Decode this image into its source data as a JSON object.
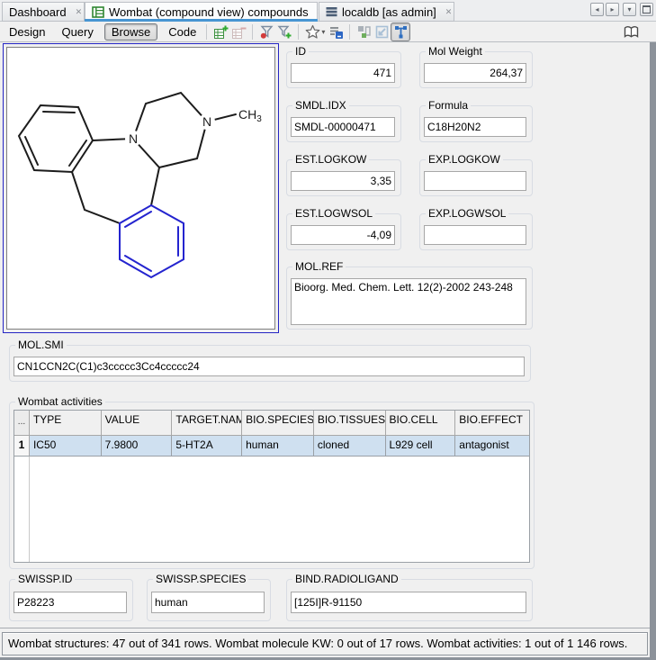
{
  "tabs": {
    "items": [
      {
        "label": "Dashboard",
        "close": "✕"
      },
      {
        "label": "Wombat (compound view) compounds",
        "close": "✕"
      },
      {
        "label": "localdb [as admin]",
        "close": "✕"
      }
    ]
  },
  "window_buttons": {
    "back": "◂",
    "forward": "▸",
    "menu": "▾"
  },
  "toolbar": {
    "design": "Design",
    "query": "Query",
    "browse": "Browse",
    "code": "Code",
    "star_caret": "▾"
  },
  "fields": {
    "id": {
      "label": "ID",
      "value": "471"
    },
    "mol_weight": {
      "label": "Mol Weight",
      "value": "264,37"
    },
    "smdl_idx": {
      "label": "SMDL.IDX",
      "value": "SMDL-00000471"
    },
    "formula": {
      "label": "Formula",
      "value": "C18H20N2"
    },
    "est_logkow": {
      "label": "EST.LOGKOW",
      "value": "3,35"
    },
    "exp_logkow": {
      "label": "EXP.LOGKOW",
      "value": ""
    },
    "est_logwsol": {
      "label": "EST.LOGWSOL",
      "value": "-4,09"
    },
    "exp_logwsol": {
      "label": "EXP.LOGWSOL",
      "value": ""
    },
    "mol_ref": {
      "label": "MOL.REF",
      "value": "Bioorg. Med. Chem. Lett. 12(2)-2002 243-248"
    },
    "mol_smi": {
      "label": "MOL.SMI",
      "value": "CN1CCN2C(C1)c3ccccc3Cc4ccccc24"
    },
    "swissp_id": {
      "label": "SWISSP.ID",
      "value": "P28223"
    },
    "swissp_species": {
      "label": "SWISSP.SPECIES",
      "value": "human"
    },
    "bind_radioligand": {
      "label": "BIND.RADIOLIGAND",
      "value": "[125I]R-91150"
    }
  },
  "activities": {
    "label": "Wombat activities",
    "corner": "...",
    "columns": [
      "TYPE",
      "VALUE",
      "TARGET.NAME",
      "BIO.SPECIES",
      "BIO.TISSUESOU",
      "BIO.CELL",
      "BIO.EFFECT"
    ],
    "rows": [
      {
        "num": "1",
        "cells": [
          "IC50",
          "7.9800",
          "5-HT2A",
          "human",
          "cloned",
          "L929 cell",
          "antagonist"
        ]
      }
    ]
  },
  "molecule": {
    "n1": "N",
    "n2": "N",
    "ch3": "CH",
    "ch3_sub": "3"
  },
  "status": {
    "text": "Wombat structures: 47 out of 341 rows. Wombat molecule KW: 0 out of 17 rows. Wombat activities: 1 out of 1 146 rows."
  },
  "colors": {
    "accent_tab_blue": "#4795d2",
    "molecule_blue": "#2424cf",
    "panel_border_blue": "#2525c4",
    "selected_row_blue": "#cfe0f0",
    "icon_green": "#2f8632",
    "icon_red": "#d23b3b"
  }
}
